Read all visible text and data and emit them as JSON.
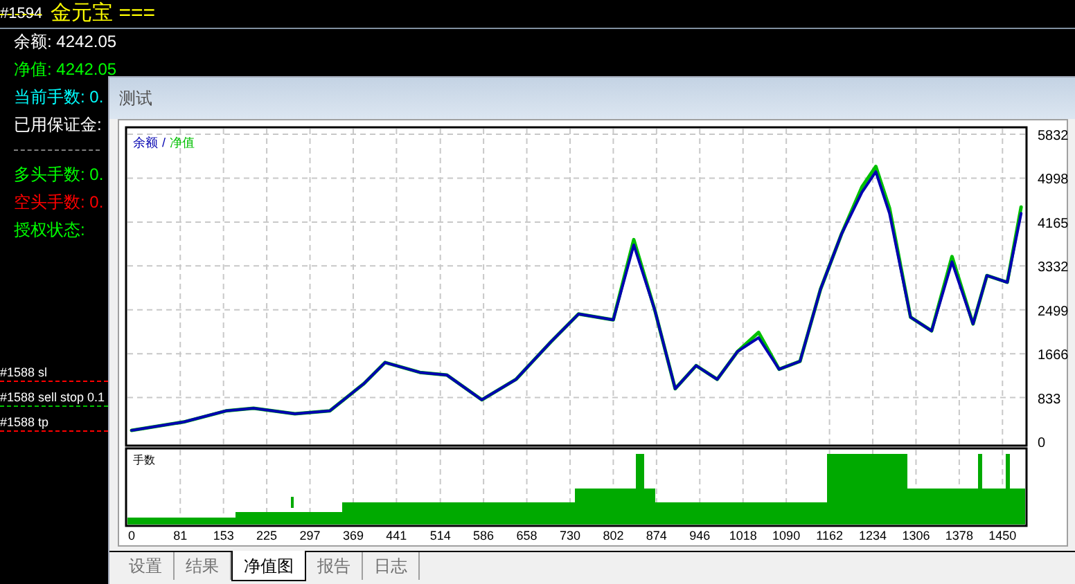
{
  "terminal": {
    "header": {
      "order": "#1594",
      "title": "金元宝 ==="
    },
    "lines": [
      {
        "kind": "text",
        "text": "余额: 4242.05",
        "color": "#ffffff"
      },
      {
        "kind": "text",
        "text": "净值: 4242.05",
        "color": "#00ff00"
      },
      {
        "kind": "text",
        "text": "当前手数: 0.",
        "color": "#00ffff"
      },
      {
        "kind": "text",
        "text": "已用保证金:",
        "color": "#ffffff"
      },
      {
        "kind": "rule",
        "color": "#808080"
      },
      {
        "kind": "text",
        "text": "多头手数: 0.",
        "color": "#00ff00"
      },
      {
        "kind": "text",
        "text": "空头手数: 0.",
        "color": "#ff0000"
      },
      {
        "kind": "text",
        "text": "授权状态:",
        "color": "#00ff00"
      }
    ],
    "orders": [
      {
        "text": "#1588 sl",
        "color": "#ff0000"
      },
      {
        "text": "#1588 sell stop 0.1",
        "color": "#00c000"
      },
      {
        "text": "#1588 tp",
        "color": "#ff0000"
      }
    ]
  },
  "window": {
    "title": "测试",
    "legend_separator": "/",
    "chart_data": {
      "type": "line",
      "grid": true,
      "xlim": [
        0,
        1490
      ],
      "ylim": [
        0,
        5832
      ],
      "xticks": [
        0,
        81,
        153,
        225,
        297,
        369,
        441,
        514,
        586,
        658,
        730,
        802,
        874,
        946,
        1018,
        1090,
        1162,
        1234,
        1306,
        1378,
        1450
      ],
      "yticks": [
        0,
        833,
        1666,
        2499,
        3332,
        4165,
        4998,
        5832
      ],
      "x": [
        0,
        87,
        157,
        203,
        272,
        330,
        387,
        422,
        480,
        525,
        583,
        640,
        698,
        744,
        802,
        836,
        871,
        905,
        940,
        975,
        1009,
        1044,
        1078,
        1113,
        1147,
        1182,
        1216,
        1239,
        1262,
        1297,
        1332,
        1366,
        1401,
        1424,
        1458,
        1481
      ],
      "series": [
        {
          "name": "余额",
          "color": "#0000b0",
          "values": [
            210,
            370,
            580,
            630,
            525,
            580,
            1100,
            1500,
            1310,
            1260,
            790,
            1180,
            1890,
            2420,
            2310,
            3730,
            2500,
            1000,
            1440,
            1180,
            1710,
            1970,
            1370,
            1520,
            2890,
            3940,
            4730,
            5120,
            4330,
            2360,
            2100,
            3410,
            2230,
            3150,
            3020,
            4330
          ]
        },
        {
          "name": "净值",
          "color": "#00c000",
          "values": [
            210,
            370,
            580,
            630,
            525,
            580,
            1100,
            1500,
            1310,
            1260,
            790,
            1180,
            1890,
            2420,
            2310,
            3830,
            2500,
            1000,
            1440,
            1180,
            1710,
            2070,
            1370,
            1520,
            2890,
            3940,
            4830,
            5220,
            4430,
            2360,
            2100,
            3510,
            2230,
            3150,
            3020,
            4450
          ]
        }
      ]
    },
    "lots_label": "手数",
    "tabs": [
      {
        "label": "设置",
        "selected": false
      },
      {
        "label": "结果",
        "selected": false
      },
      {
        "label": "净值图",
        "selected": true
      },
      {
        "label": "报告",
        "selected": false
      },
      {
        "label": "日志",
        "selected": false
      }
    ]
  }
}
